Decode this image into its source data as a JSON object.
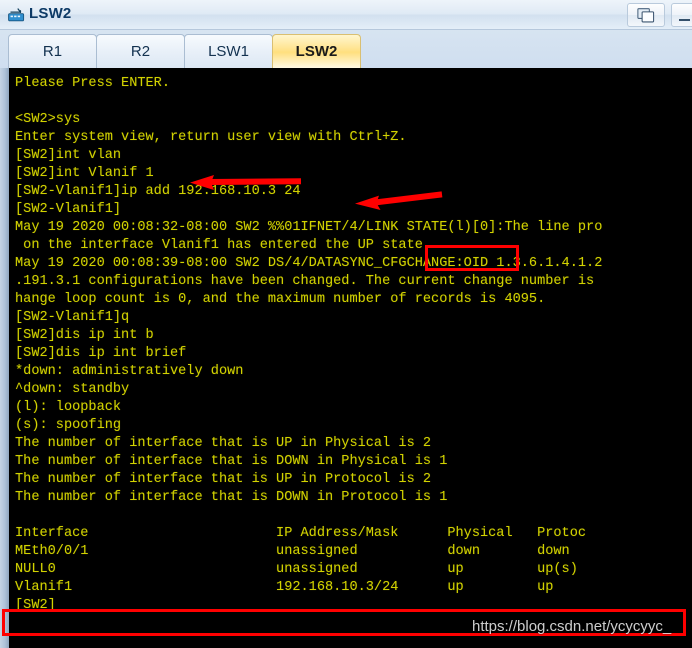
{
  "window": {
    "title": "LSW2",
    "icon": "switch-icon",
    "controls": [
      {
        "name": "restore-button",
        "icon": "restore-window-icon",
        "label": ""
      },
      {
        "name": "minimize-button",
        "icon": "minimize-icon",
        "label": ""
      }
    ]
  },
  "tabs": {
    "active_index": 3,
    "items": [
      {
        "label": "R1"
      },
      {
        "label": "R2"
      },
      {
        "label": "LSW1"
      },
      {
        "label": "LSW2"
      }
    ]
  },
  "terminal": {
    "foreground": "#d2d200",
    "background": "#000000",
    "lines": [
      "Please Press ENTER.",
      "",
      "<SW2>sys",
      "Enter system view, return user view with Ctrl+Z.",
      "[SW2]int vlan",
      "[SW2]int Vlanif 1",
      "[SW2-Vlanif1]ip add 192.168.10.3 24",
      "[SW2-Vlanif1]",
      "May 19 2020 00:08:32-08:00 SW2 %%01IFNET/4/LINK STATE(l)[0]:The line pro",
      " on the interface Vlanif1 has entered the UP state.",
      "May 19 2020 00:08:39-08:00 SW2 DS/4/DATASYNC_CFGCHANGE:OID 1.3.6.1.4.1.2",
      ".191.3.1 configurations have been changed. The current change number is",
      "hange loop count is 0, and the maximum number of records is 4095.",
      "[SW2-Vlanif1]q",
      "[SW2]dis ip int b",
      "[SW2]dis ip int brief",
      "*down: administratively down",
      "^down: standby",
      "(l): loopback",
      "(s): spoofing",
      "The number of interface that is UP in Physical is 2",
      "The number of interface that is DOWN in Physical is 1",
      "The number of interface that is UP in Protocol is 2",
      "The number of interface that is DOWN in Protocol is 1",
      "",
      "Interface                       IP Address/Mask      Physical   Protoc",
      "MEth0/0/1                       unassigned           down       down",
      "NULL0                           unassigned           up         up(s)",
      "Vlanif1                         192.168.10.3/24      up         up",
      "[SW2]"
    ]
  },
  "annotations": {
    "color": "#ff0000",
    "highlight_boxes": [
      {
        "name": "up-state-highlight",
        "target_text": "UP state."
      },
      {
        "name": "vlanif1-row-highlight",
        "target_text": "Vlanif1  192.168.10.3/24  up  up"
      }
    ],
    "arrows": [
      {
        "name": "arrow-int-vlanif",
        "direction": "left",
        "target_text": "[SW2]int Vlanif 1"
      },
      {
        "name": "arrow-ip-add",
        "direction": "left",
        "target_text": "ip add 192.168.10.3 24"
      }
    ]
  },
  "watermark": {
    "text": "https://blog.csdn.net/ycycyyc_"
  }
}
